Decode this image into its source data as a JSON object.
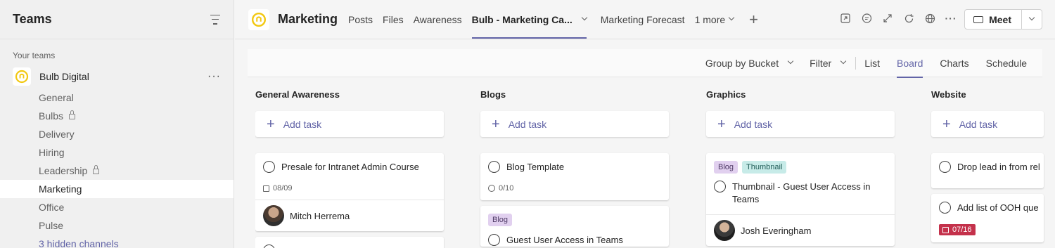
{
  "sidebar": {
    "title": "Teams",
    "section_label": "Your teams",
    "team_name": "Bulb Digital",
    "more_label": "···",
    "channels": [
      {
        "label": "General",
        "locked": false,
        "active": false
      },
      {
        "label": "Bulbs",
        "locked": true,
        "active": false
      },
      {
        "label": "Delivery",
        "locked": false,
        "active": false
      },
      {
        "label": "Hiring",
        "locked": false,
        "active": false
      },
      {
        "label": "Leadership",
        "locked": true,
        "active": false
      },
      {
        "label": "Marketing",
        "locked": false,
        "active": true
      },
      {
        "label": "Office",
        "locked": false,
        "active": false
      },
      {
        "label": "Pulse",
        "locked": false,
        "active": false
      }
    ],
    "hidden_channels": "3 hidden channels"
  },
  "topbar": {
    "channel_name": "Marketing",
    "tabs": [
      {
        "label": "Posts"
      },
      {
        "label": "Files"
      },
      {
        "label": "Awareness"
      },
      {
        "label": "Bulb - Marketing Ca..."
      },
      {
        "label": "Marketing Forecast"
      },
      {
        "label": "1 more"
      }
    ],
    "add_tab": "+",
    "meet_label": "Meet"
  },
  "toolbar": {
    "group_by": "Group by Bucket",
    "filter": "Filter",
    "views": [
      "List",
      "Board",
      "Charts",
      "Schedule"
    ],
    "active_view": "Board"
  },
  "board": {
    "add_task_label": "Add task",
    "buckets": [
      {
        "title": "General Awareness",
        "cards": [
          {
            "title": "Presale for Intranet Admin Course",
            "due": "08/09",
            "assignee": "Mitch Herrema"
          }
        ]
      },
      {
        "title": "Blogs",
        "cards": [
          {
            "title": "Blog Template",
            "checklist": "0/10"
          },
          {
            "tag": "Blog",
            "title": "Guest User Access in Teams"
          }
        ]
      },
      {
        "title": "Graphics",
        "cards": [
          {
            "tags": [
              "Blog",
              "Thumbnail"
            ],
            "title": "Thumbnail - Guest User Access in Teams",
            "assignee": "Josh Everingham"
          }
        ]
      },
      {
        "title": "Website",
        "cards": [
          {
            "title": "Drop lead in from rel"
          },
          {
            "title": "Add list of OOH que",
            "due": "07/16"
          }
        ]
      }
    ]
  },
  "colors": {
    "accent": "#6264a7",
    "overdue": "#c4314b",
    "logo_yellow": "#f2c811"
  }
}
